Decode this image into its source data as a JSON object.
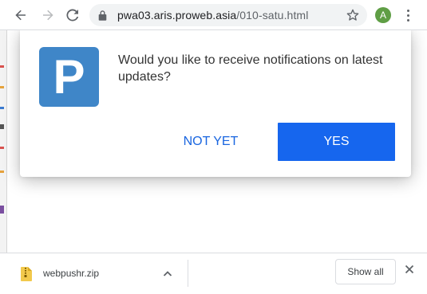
{
  "toolbar": {
    "url_host": "pwa03.aris.proweb.asia",
    "url_path": "/010-satu.html",
    "profile_initial": "A",
    "icons": [
      "back-arrow-icon",
      "forward-arrow-icon",
      "reload-icon",
      "lock-icon",
      "star-icon",
      "kebab-menu-icon"
    ]
  },
  "prompt": {
    "logo_letter": "P",
    "message": "Would you like to receive notifications on latest updates?",
    "not_yet_label": "NOT YET",
    "yes_label": "YES"
  },
  "downloads": {
    "file_name": "webpushr.zip",
    "show_all_label": "Show all",
    "icons": [
      "zip-file-icon",
      "chevron-up-icon",
      "close-icon"
    ]
  },
  "colors": {
    "logo_bg": "#3f86c8",
    "yes_bg": "#1666ee",
    "not_yet_text": "#1a66e0",
    "avatar_bg": "#5f9e45"
  }
}
